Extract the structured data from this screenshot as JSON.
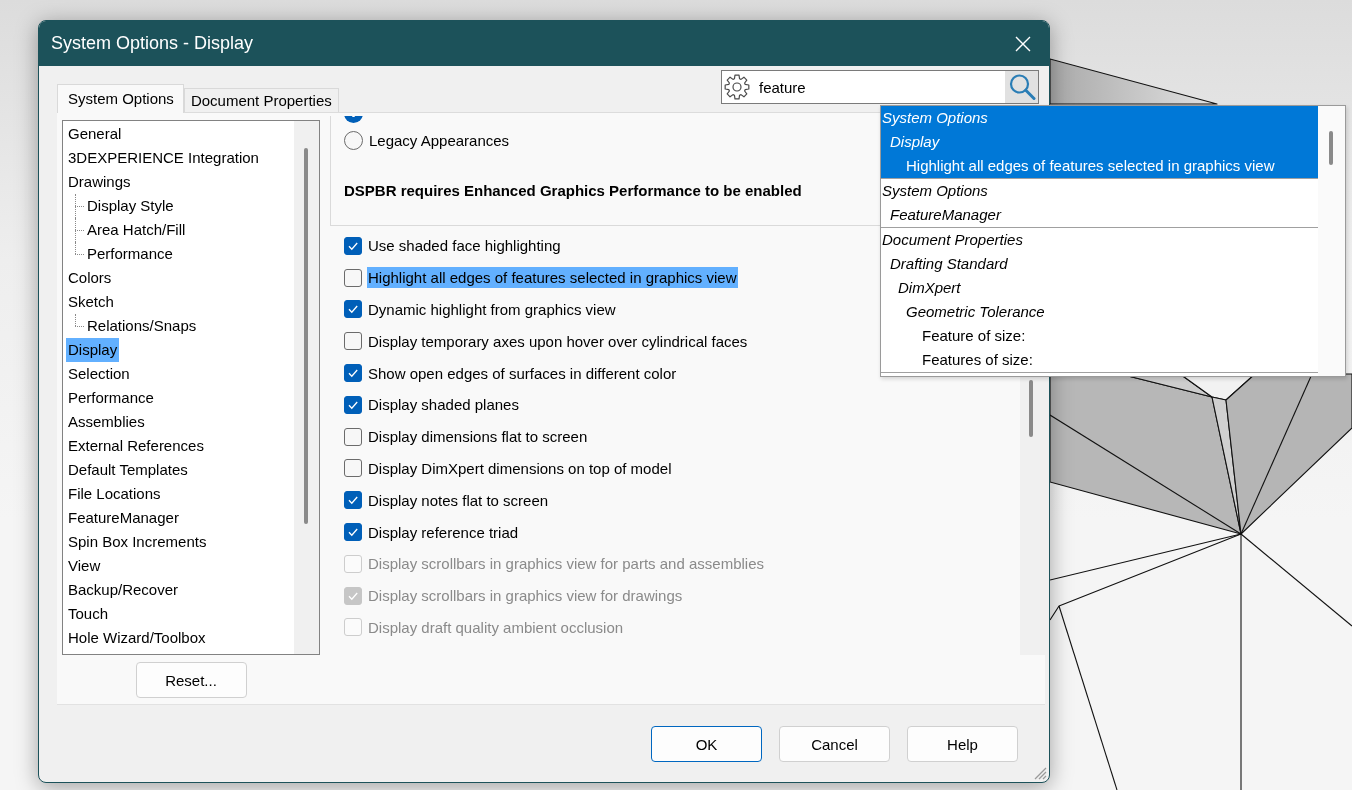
{
  "window": {
    "title": "System Options - Display"
  },
  "tabs": [
    {
      "label": "System Options",
      "selected": true
    },
    {
      "label": "Document Properties",
      "selected": false
    }
  ],
  "search": {
    "value": "feature"
  },
  "search_results": [
    {
      "selected": true,
      "node": {
        "kind": "category",
        "text": "System Options",
        "children": [
          {
            "kind": "category",
            "text": "Display",
            "children": [
              {
                "kind": "option",
                "text": "Highlight all edges of features selected in graphics view"
              }
            ]
          }
        ]
      }
    },
    {
      "selected": false,
      "node": {
        "kind": "category",
        "text": "System Options",
        "children": [
          {
            "kind": "category",
            "text": "FeatureManager"
          }
        ]
      }
    },
    {
      "selected": false,
      "node": {
        "kind": "category",
        "text": "Document Properties",
        "children": [
          {
            "kind": "category",
            "text": "Drafting Standard",
            "children": [
              {
                "kind": "category",
                "text": "DimXpert",
                "children": [
                  {
                    "kind": "category",
                    "text": "Geometric Tolerance",
                    "children": [
                      {
                        "kind": "option",
                        "text": "Feature of size:"
                      },
                      {
                        "kind": "option",
                        "text": "Features of size:"
                      }
                    ]
                  }
                ]
              }
            ]
          }
        ]
      }
    }
  ],
  "sidebar": {
    "items": [
      {
        "label": "General",
        "selected": false
      },
      {
        "label": "3DEXPERIENCE Integration",
        "selected": false
      },
      {
        "label": "Drawings",
        "selected": false,
        "children": [
          {
            "label": "Display Style",
            "selected": false
          },
          {
            "label": "Area Hatch/Fill",
            "selected": false
          },
          {
            "label": "Performance",
            "selected": false
          }
        ]
      },
      {
        "label": "Colors",
        "selected": false
      },
      {
        "label": "Sketch",
        "selected": false,
        "children": [
          {
            "label": "Relations/Snaps",
            "selected": false
          }
        ]
      },
      {
        "label": "Display",
        "selected": true
      },
      {
        "label": "Selection",
        "selected": false
      },
      {
        "label": "Performance",
        "selected": false
      },
      {
        "label": "Assemblies",
        "selected": false
      },
      {
        "label": "External References",
        "selected": false
      },
      {
        "label": "Default Templates",
        "selected": false
      },
      {
        "label": "File Locations",
        "selected": false
      },
      {
        "label": "FeatureManager",
        "selected": false
      },
      {
        "label": "Spin Box Increments",
        "selected": false
      },
      {
        "label": "View",
        "selected": false
      },
      {
        "label": "Backup/Recover",
        "selected": false
      },
      {
        "label": "Touch",
        "selected": false
      },
      {
        "label": "Hole Wizard/Toolbox",
        "selected": false
      }
    ]
  },
  "reset_button": "Reset...",
  "display_settings": {
    "appearance_options": [
      {
        "selected": true
      },
      {
        "label": "Legacy Appearances",
        "selected": false
      }
    ],
    "notice": "DSPBR requires Enhanced Graphics Performance to be enabled",
    "options": [
      {
        "label": "Use shaded face highlighting",
        "checked": true,
        "disabled": false,
        "highlighted": false
      },
      {
        "label": "Highlight all edges of features selected in graphics view",
        "checked": false,
        "disabled": false,
        "highlighted": true
      },
      {
        "label": "Dynamic highlight from graphics view",
        "checked": true,
        "disabled": false,
        "highlighted": false
      },
      {
        "label": "Display temporary axes upon hover over cylindrical faces",
        "checked": false,
        "disabled": false,
        "highlighted": false
      },
      {
        "label": "Show open edges of surfaces in different color",
        "checked": true,
        "disabled": false,
        "highlighted": false
      },
      {
        "label": "Display shaded planes",
        "checked": true,
        "disabled": false,
        "highlighted": false
      },
      {
        "label": "Display dimensions flat to screen",
        "checked": false,
        "disabled": false,
        "highlighted": false
      },
      {
        "label": "Display DimXpert dimensions on top of model",
        "checked": false,
        "disabled": false,
        "highlighted": false
      },
      {
        "label": "Display notes flat to screen",
        "checked": true,
        "disabled": false,
        "highlighted": false
      },
      {
        "label": "Display reference triad",
        "checked": true,
        "disabled": false,
        "highlighted": false
      },
      {
        "label": "Display scrollbars in graphics view for parts and assemblies",
        "checked": false,
        "disabled": true,
        "highlighted": false
      },
      {
        "label": "Display scrollbars in graphics view for drawings",
        "checked": true,
        "disabled": true,
        "highlighted": false
      },
      {
        "label": "Display draft quality ambient occlusion",
        "checked": false,
        "disabled": true,
        "highlighted": false
      }
    ]
  },
  "buttons": [
    {
      "label": "OK",
      "default": true
    },
    {
      "label": "Cancel",
      "default": false
    },
    {
      "label": "Help",
      "default": false
    }
  ]
}
